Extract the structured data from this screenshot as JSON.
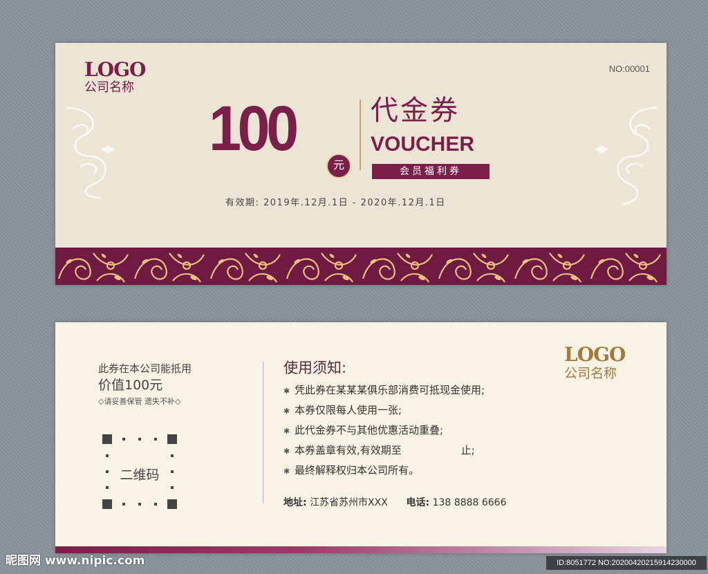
{
  "front": {
    "logo_mark": "LOGO",
    "logo_name": "公司名称",
    "serial": "NO:00001",
    "amount": "100",
    "amount_unit": "元",
    "title_cn": "代金券",
    "title_en": "VOUCHER",
    "member_badge": "会员福利券",
    "validity": "有效期: 2019年.12月.1日 - 2020年.12月.1日"
  },
  "back": {
    "line1": "此券在本公司能抵用",
    "line2": "价值100元",
    "line3": "◇请妥善保管 遗失不补◇",
    "qr_label": "二维码",
    "notice_title": "使用须知:",
    "rules": [
      "凭此券在某某某俱乐部消费可抵现金使用;",
      "本券仅限每人使用一张;",
      "此代金券不与其他优惠活动重叠;",
      "本券盖章有效,有效期至                  止;",
      "最终解释权归本公司所有。"
    ],
    "address_label": "地址:",
    "address_value": "江苏省苏州市XXX",
    "phone_label": "电话:",
    "phone_value": "138 8888 6666",
    "logo_mark": "LOGO",
    "logo_name": "公司名称"
  },
  "watermark": {
    "site": "昵图网 www.nipic.com",
    "id": "ID:8051772 NO:20200420215914230000"
  },
  "colors": {
    "burgundy": "#7a1f4a",
    "gold": "#e3cf97",
    "front_bg": "#ece4d5",
    "back_bg": "#f8f3e4"
  }
}
